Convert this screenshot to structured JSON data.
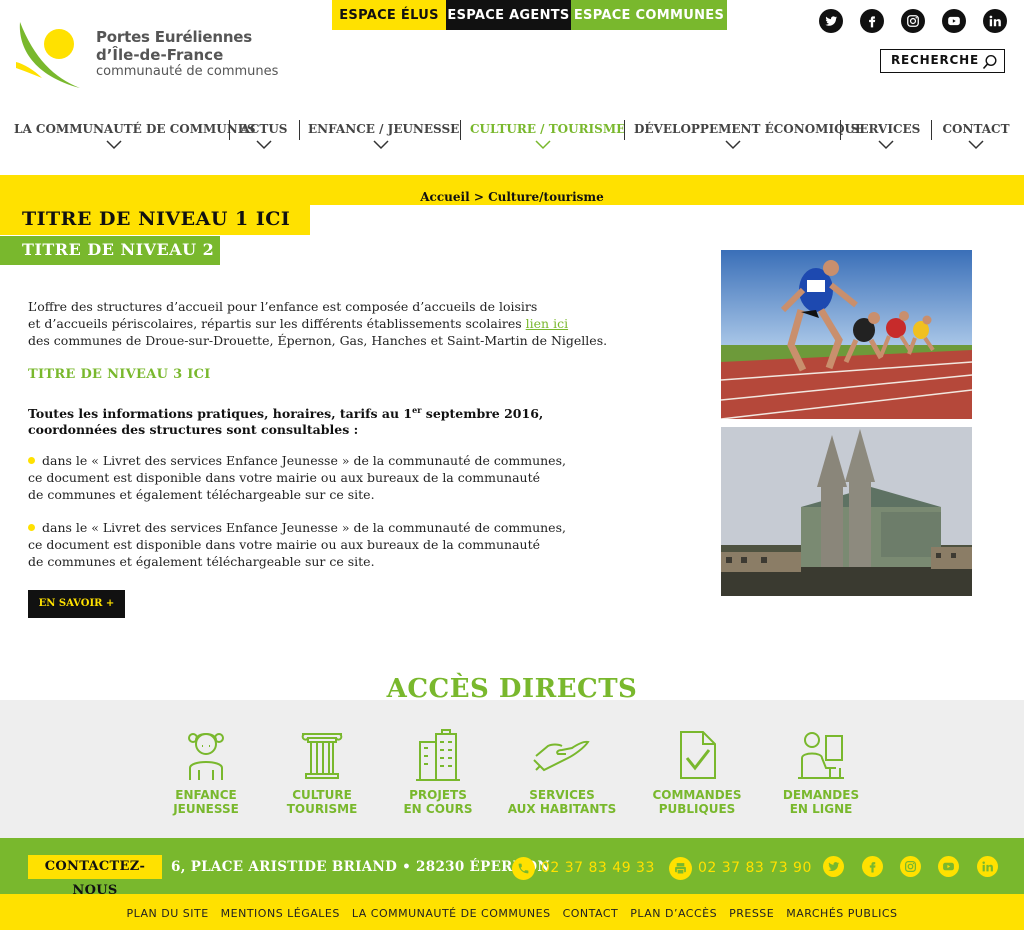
{
  "logo": {
    "line1": "Portes Euréliennes",
    "line2": "d’Île-de-France",
    "line3": "communauté de communes"
  },
  "espaces": [
    {
      "label": "ESPACE ÉLUS",
      "color": "#ffe100"
    },
    {
      "label": "ESPACE AGENTS",
      "color": "#111111"
    },
    {
      "label": "ESPACE COMMUNES",
      "color": "#79b82d"
    }
  ],
  "social": [
    "twitter-icon",
    "facebook-icon",
    "instagram-icon",
    "youtube-icon",
    "linkedin-icon"
  ],
  "search": {
    "label": "RECHERCHE"
  },
  "nav": [
    {
      "label": "LA COMMUNAUTÉ DE COMMUNES",
      "active": false
    },
    {
      "label": "ACTUS",
      "active": false
    },
    {
      "label": "ENFANCE / JEUNESSE",
      "active": false
    },
    {
      "label": "CULTURE / TOURISME",
      "active": true
    },
    {
      "label": "DÉVELOPPEMENT ÉCONOMIQUE",
      "active": false
    },
    {
      "label": "SERVICES",
      "active": false
    },
    {
      "label": "CONTACT",
      "active": false
    }
  ],
  "breadcrumb": {
    "home": "Accueil",
    "sep": ">",
    "current": "Culture/tourisme"
  },
  "titles": {
    "h1": "TITRE DE NIVEAU 1 ICI",
    "h2": "TITRE DE NIVEAU 2",
    "h3": "TITRE DE NIVEAU 3 ICI"
  },
  "content": {
    "intro_line1": "L’offre des structures d’accueil pour l’enfance est composée d’accueils de loisirs",
    "intro_line2_pre": "et d’accueils périscolaires, répartis sur les différents établissements scolaires",
    "intro_link": "lien ici",
    "intro_line3": "des communes de Droue-sur-Drouette, Épernon, Gas, Hanches et Saint-Martin de Nigelles.",
    "bold_line1_pre": "Toutes les informations pratiques, horaires, tarifs au 1",
    "bold_sup": "er",
    "bold_line1_post": " septembre 2016,",
    "bold_line2": "coordonnées des structures sont consultables :",
    "bullets": [
      {
        "l1": "dans le « Livret des services Enfance Jeunesse » de la communauté de communes,",
        "l2": "ce document est disponible dans votre mairie ou aux bureaux de la communauté",
        "l3": "de communes et également téléchargeable sur ce site."
      },
      {
        "l1": "dans le « Livret des services Enfance Jeunesse » de la communauté de communes,",
        "l2": "ce document est disponible dans votre mairie ou aux bureaux de la communauté",
        "l3": "de communes et également téléchargeable sur ce site."
      }
    ],
    "button": "EN SAVOIR +"
  },
  "acces": {
    "title": "ACCÈS DIRECTS",
    "items": [
      {
        "l1": "ENFANCE",
        "l2": "JEUNESSE",
        "icon": "child-icon"
      },
      {
        "l1": "CULTURE",
        "l2": "TOURISME",
        "icon": "column-icon"
      },
      {
        "l1": "PROJETS",
        "l2": "EN COURS",
        "icon": "buildings-icon"
      },
      {
        "l1": "SERVICES",
        "l2": "AUX HABITANTS",
        "icon": "hand-icon"
      },
      {
        "l1": "COMMANDES",
        "l2": "PUBLIQUES",
        "icon": "document-check-icon"
      },
      {
        "l1": "DEMANDES",
        "l2": "EN LIGNE",
        "icon": "computer-user-icon"
      }
    ]
  },
  "contact": {
    "label": "CONTACTEZ-NOUS",
    "address": "6, PLACE ARISTIDE BRIAND • 28230 ÉPERNON",
    "phone": "02 37 83 49 33",
    "fax": "02 37 83 73 90"
  },
  "footer": [
    "PLAN DU SITE",
    "MENTIONS LÉGALES",
    "LA COMMUNAUTÉ DE COMMUNES",
    "CONTACT",
    "PLAN D’ACCÈS",
    "PRESSE",
    "MARCHÉS PUBLICS"
  ],
  "colors": {
    "yellow": "#ffe100",
    "green": "#79b82d",
    "black": "#111111"
  }
}
